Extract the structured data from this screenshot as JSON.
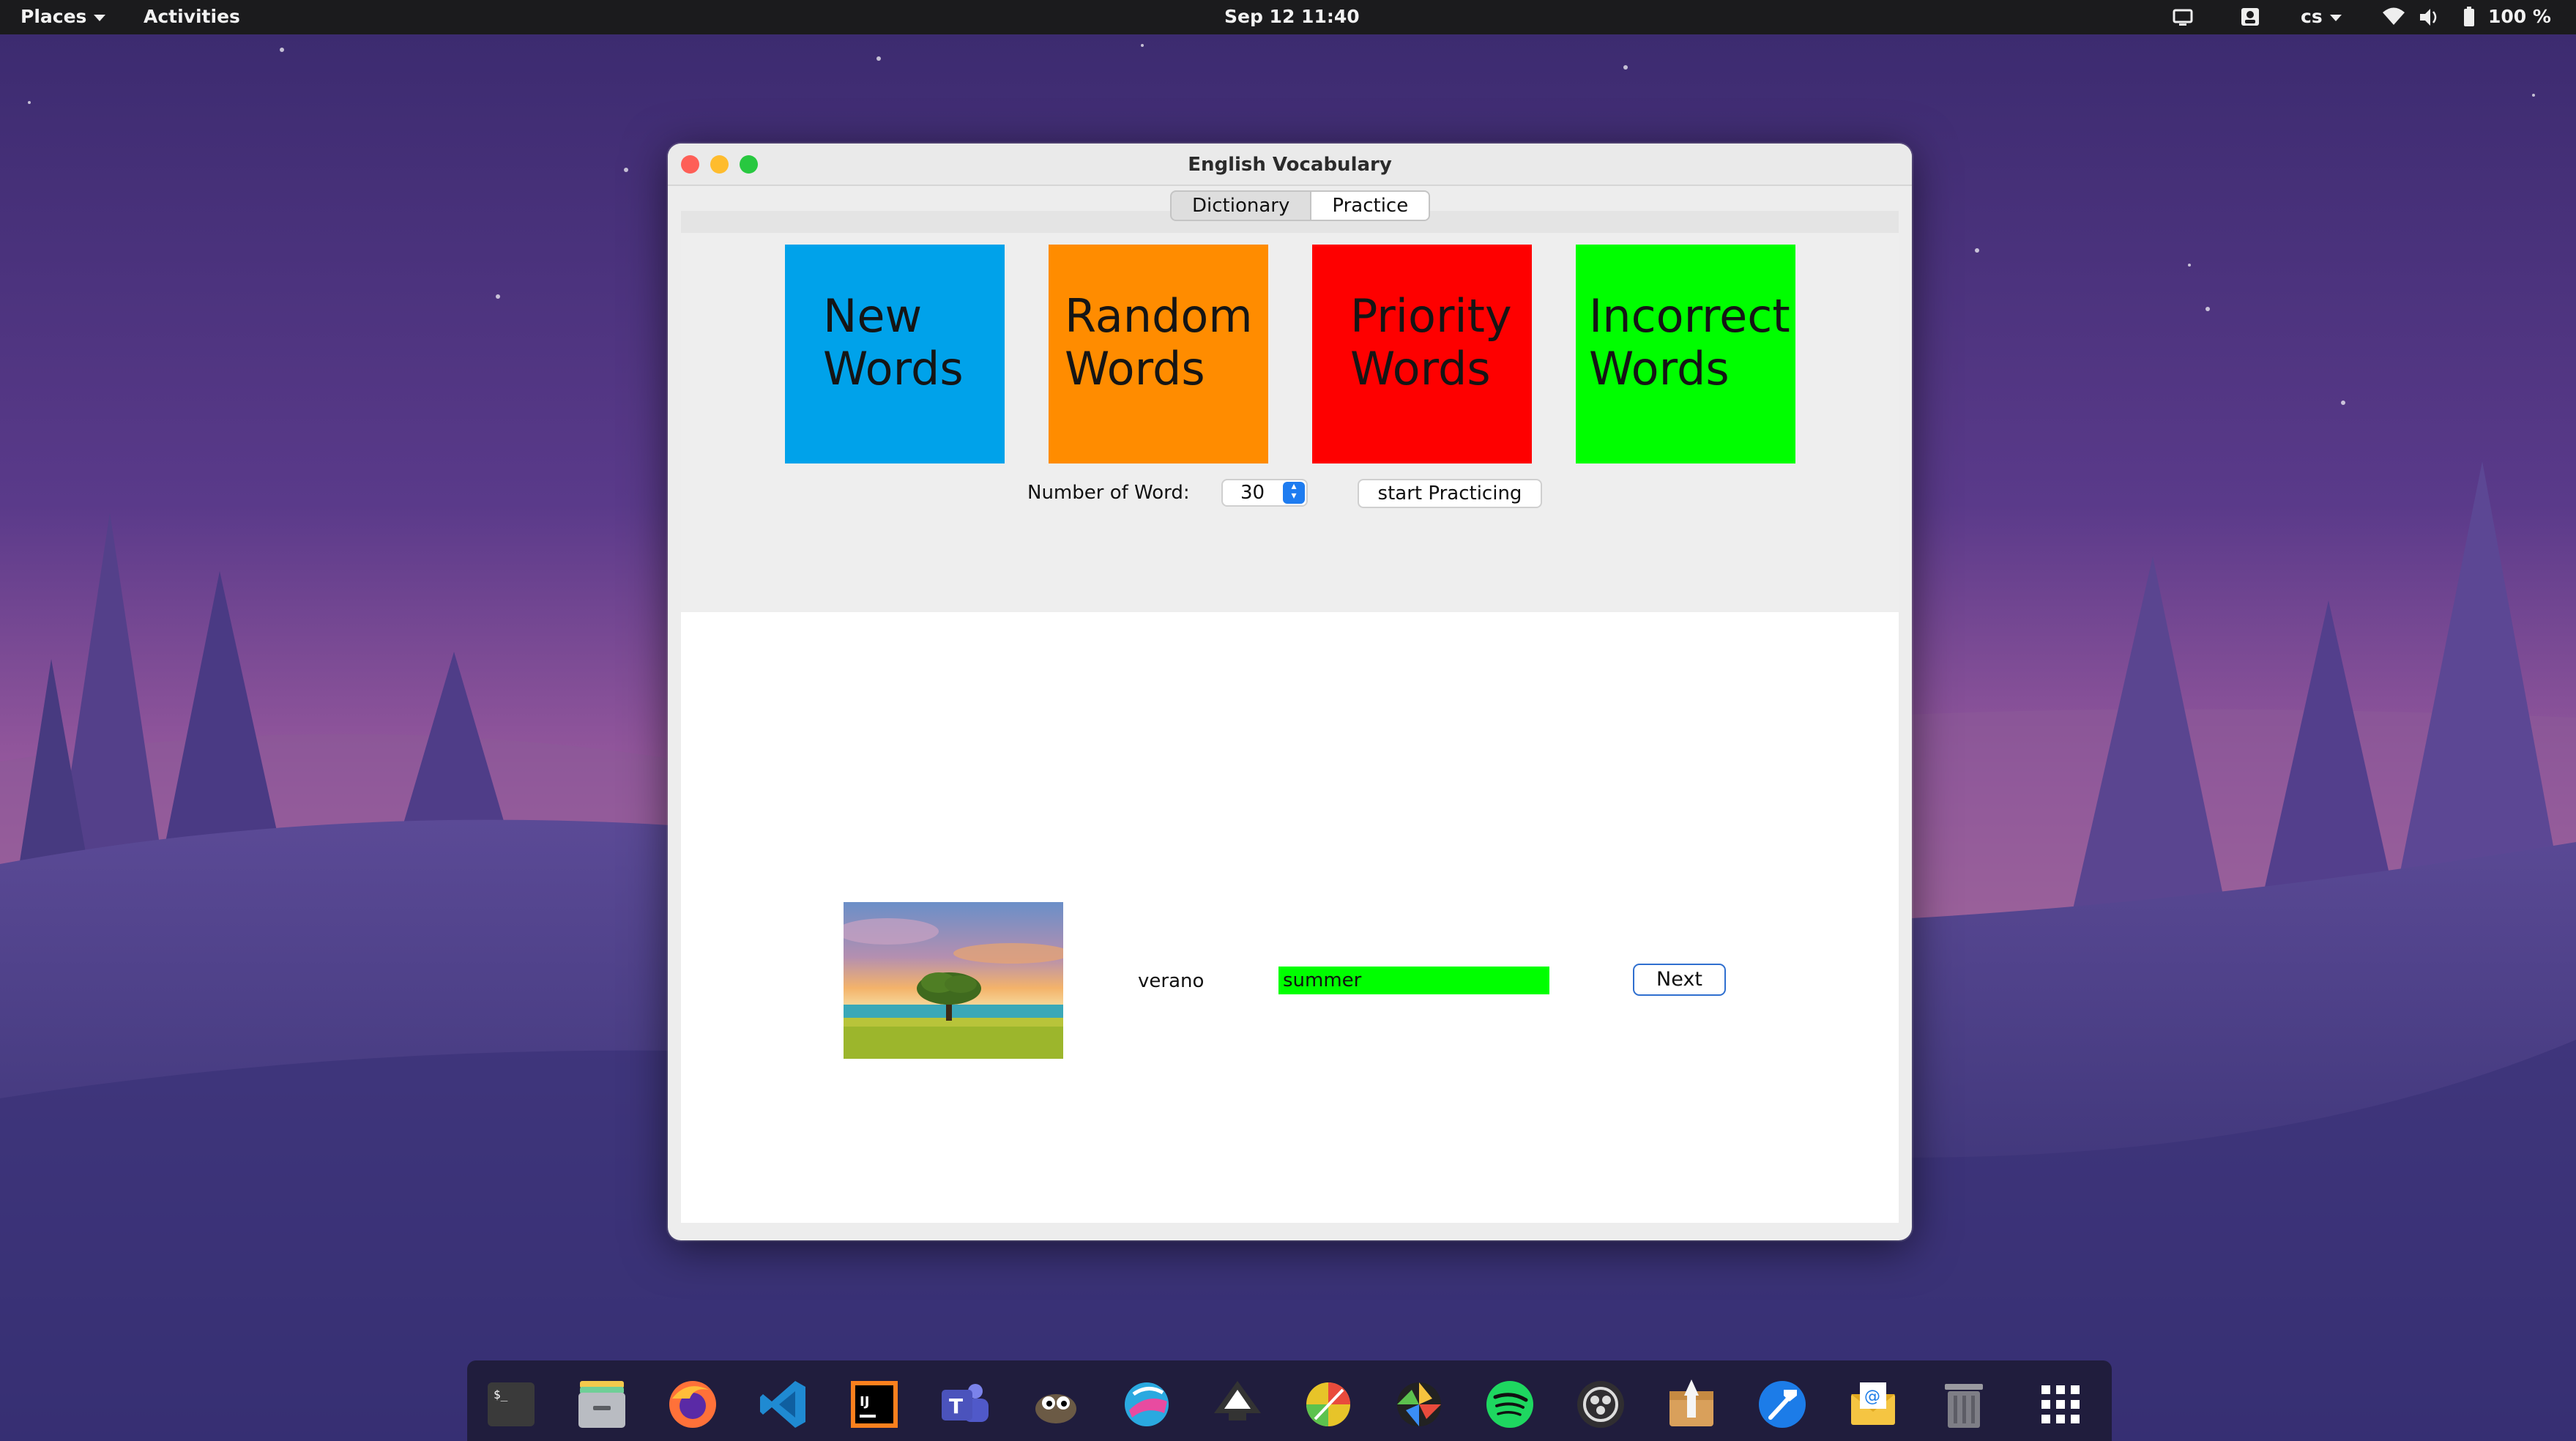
{
  "topbar": {
    "places": "Places",
    "activities": "Activities",
    "datetime": "Sep 12  11:40",
    "lang": "cs",
    "battery": "100 %"
  },
  "window": {
    "title": "English Vocabulary",
    "tabs": [
      {
        "label": "Dictionary",
        "selected": false
      },
      {
        "label": "Practice",
        "selected": true
      }
    ]
  },
  "practice": {
    "tiles": [
      {
        "line1": "New",
        "line2": "Words",
        "color": "#00a2ea"
      },
      {
        "line1": "Random",
        "line2": "Words",
        "color": "#ff8c00"
      },
      {
        "line1": "Priority",
        "line2": "Words",
        "color": "#fe0000"
      },
      {
        "line1": "Incorrect",
        "line2": "Words",
        "color": "#00fe00"
      }
    ],
    "count_label": "Number of Word:",
    "count_value": "30",
    "start_label": "start Practicing",
    "word": "verano",
    "answer": "summer",
    "answer_color": "#00ff00",
    "next_label": "Next"
  },
  "dock": {
    "icons": [
      "terminal-icon",
      "files-icon",
      "firefox-icon",
      "vscode-icon",
      "intellij-icon",
      "teams-icon",
      "gimp-icon",
      "krita-icon",
      "inkscape-icon",
      "color-picker-icon",
      "aperture-icon",
      "spotify-icon",
      "obs-icon",
      "archive-manager-icon",
      "xcode-build-icon",
      "mail-icon",
      "trash-icon",
      "app-grid-icon"
    ]
  }
}
